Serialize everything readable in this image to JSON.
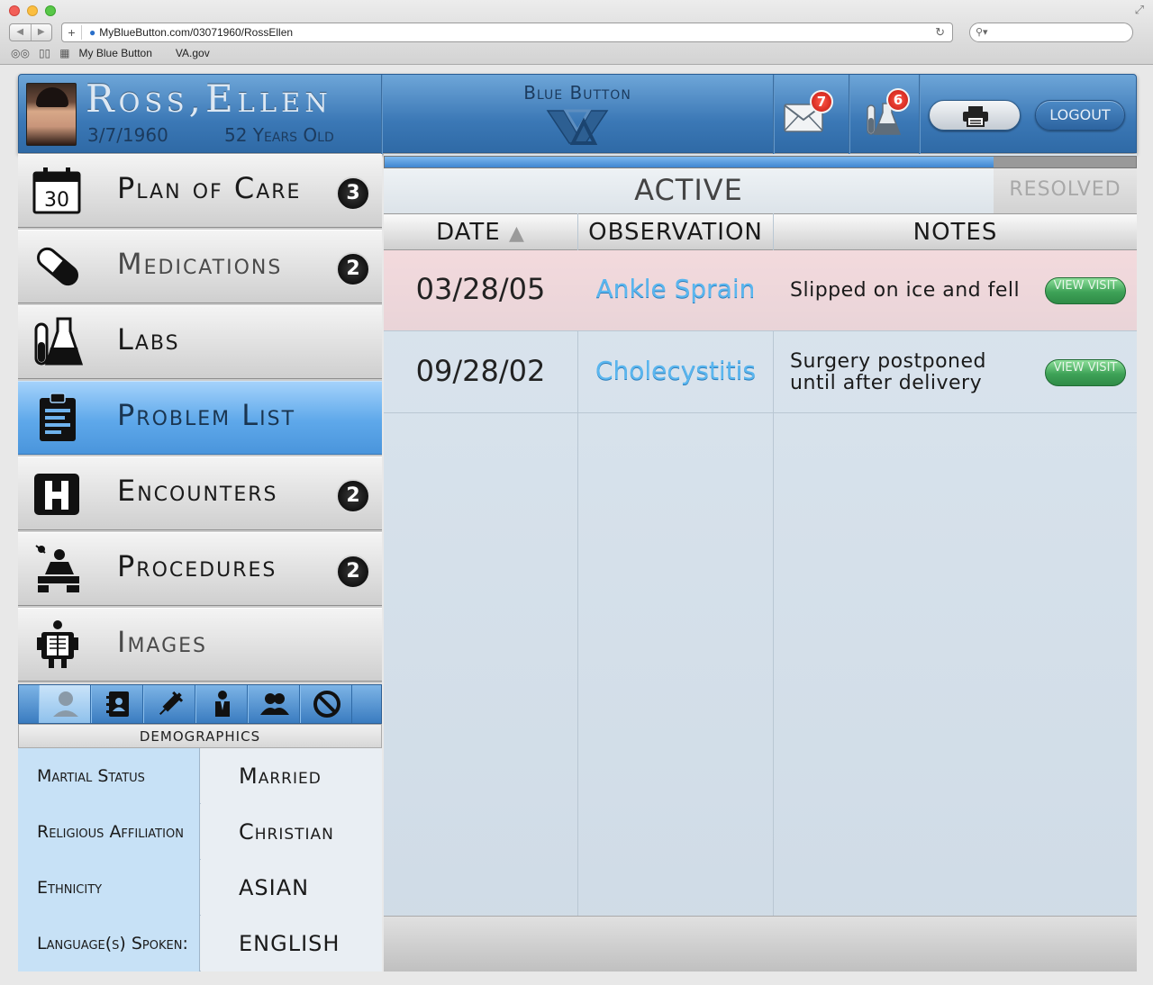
{
  "browser": {
    "url": "MyBlueButton.com/03071960/RossEllen",
    "bookmarks": [
      "My Blue Button",
      "VA.gov"
    ]
  },
  "header": {
    "patient_name": "Ross,Ellen",
    "dob": "3/7/1960",
    "age": "52 Years Old",
    "app_title": "Blue Button",
    "messages_count": "7",
    "labs_count": "6",
    "logout_label": "LOGOUT"
  },
  "sidebar": {
    "items": [
      {
        "label": "Plan of Care",
        "badge": "3",
        "icon": "calendar-icon",
        "calendar_day": "30"
      },
      {
        "label": "Medications",
        "badge": "2",
        "icon": "pill-icon"
      },
      {
        "label": "Labs",
        "badge": "",
        "icon": "flask-icon"
      },
      {
        "label": "Problem List",
        "badge": "",
        "icon": "clipboard-icon",
        "active": true
      },
      {
        "label": "Encounters",
        "badge": "2",
        "icon": "hospital-icon"
      },
      {
        "label": "Procedures",
        "badge": "2",
        "icon": "surgery-icon"
      },
      {
        "label": "Images",
        "badge": "",
        "icon": "xray-icon"
      }
    ]
  },
  "demographics": {
    "title": "DEMOGRAPHICS",
    "tabs": [
      "person-icon",
      "contacts-icon",
      "syringe-icon",
      "doctor-icon",
      "family-icon",
      "no-allergy-icon"
    ],
    "rows": [
      {
        "key": "Martial Status",
        "value": "Married"
      },
      {
        "key": "Religious Affiliation",
        "value": "Christian"
      },
      {
        "key": "Ethnicity",
        "value": "ASIAN"
      },
      {
        "key": "Language(s) Spoken:",
        "value": "ENGLISH"
      }
    ]
  },
  "problems": {
    "progress": 0.81,
    "tab_active": "ACTIVE",
    "tab_resolved": "RESOLVED",
    "columns": [
      "DATE",
      "OBSERVATION",
      "NOTES"
    ],
    "rows": [
      {
        "date": "03/28/05",
        "observation": "Ankle Sprain",
        "notes": "Slipped on ice and fell",
        "action": "View Visit"
      },
      {
        "date": "09/28/02",
        "observation": "Cholecystitis",
        "notes": "Surgery postponed until after delivery",
        "action": "View Visit"
      }
    ]
  },
  "colors": {
    "header_blue": "#3b78b6",
    "active_nav": "#5ea8ea",
    "link_blue": "#5ab6ef",
    "badge_red": "#c3150e",
    "view_green": "#3ea257"
  }
}
